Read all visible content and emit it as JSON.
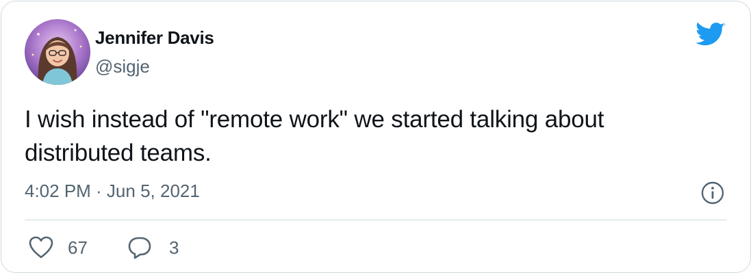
{
  "author": {
    "display_name": "Jennifer Davis",
    "handle": "@sigje"
  },
  "tweet": {
    "text": "I wish instead of \"remote work\" we started talking about distributed teams.",
    "timestamp": "4:02 PM · Jun 5, 2021"
  },
  "actions": {
    "like_count": "67",
    "reply_count": "3"
  },
  "icons": {
    "brand": "twitter-bird-icon",
    "info": "info-icon",
    "like": "heart-icon",
    "reply": "speech-bubble-icon"
  },
  "colors": {
    "brand": "#1d9bf0",
    "text": "#0f1419",
    "muted": "#536471",
    "border": "#cfd9de"
  }
}
